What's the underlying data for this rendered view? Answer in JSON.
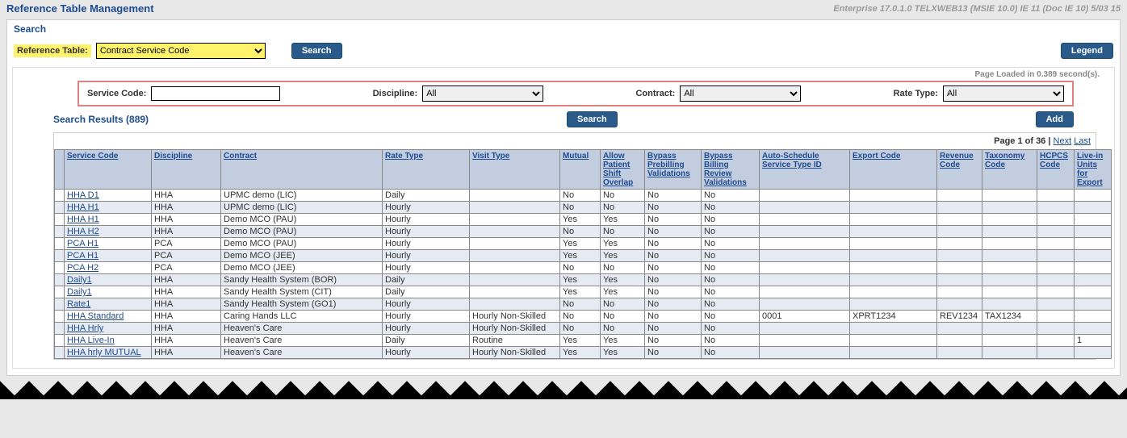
{
  "header": {
    "title": "Reference Table Management",
    "env": "Enterprise 17.0.1.0 TELXWEB13 (MSIE 10.0) IE 11 (Doc IE 10) 5/03 15"
  },
  "search": {
    "heading": "Search",
    "refTableLabel": "Reference Table:",
    "refTableValue": "Contract Service Code",
    "searchBtn": "Search",
    "legendBtn": "Legend",
    "pageLoaded": "Page Loaded in 0.389 second(s)."
  },
  "filters": {
    "serviceCodeLabel": "Service Code:",
    "serviceCodeValue": "",
    "disciplineLabel": "Discipline:",
    "disciplineValue": "All",
    "contractLabel": "Contract:",
    "contractValue": "All",
    "rateTypeLabel": "Rate Type:",
    "rateTypeValue": "All"
  },
  "results": {
    "title": "Search Results (889)",
    "searchBtn": "Search",
    "addBtn": "Add"
  },
  "pager": {
    "text": "Page 1 of 36 |",
    "next": "Next",
    "last": "Last"
  },
  "columns": [
    "Service Code",
    "Discipline",
    "Contract",
    "Rate Type",
    "Visit Type",
    "Mutual",
    "Allow Patient Shift Overlap",
    "Bypass Prebilling Validations",
    "Bypass Billing Review Validations",
    "Auto-Schedule Service Type ID",
    "Export Code",
    "Revenue Code",
    "Taxonomy Code",
    "HCPCS Code",
    "Live-in Units for Export"
  ],
  "rows": [
    {
      "sc": "HHA D1",
      "disc": "HHA",
      "con": "UPMC demo (LIC)",
      "rate": "Daily",
      "vt": "",
      "mut": "No",
      "ov": "No",
      "pre": "No",
      "bill": "No",
      "auto": "",
      "exp": "",
      "rev": "",
      "tax": "",
      "hc": "",
      "liv": ""
    },
    {
      "sc": "HHA H1",
      "disc": "HHA",
      "con": "UPMC demo (LIC)",
      "rate": "Hourly",
      "vt": "",
      "mut": "No",
      "ov": "No",
      "pre": "No",
      "bill": "No",
      "auto": "",
      "exp": "",
      "rev": "",
      "tax": "",
      "hc": "",
      "liv": ""
    },
    {
      "sc": "HHA H1",
      "disc": "HHA",
      "con": "Demo MCO (PAU)",
      "rate": "Hourly",
      "vt": "",
      "mut": "Yes",
      "ov": "Yes",
      "pre": "No",
      "bill": "No",
      "auto": "",
      "exp": "",
      "rev": "",
      "tax": "",
      "hc": "",
      "liv": ""
    },
    {
      "sc": "HHA H2",
      "disc": "HHA",
      "con": "Demo MCO (PAU)",
      "rate": "Hourly",
      "vt": "",
      "mut": "No",
      "ov": "No",
      "pre": "No",
      "bill": "No",
      "auto": "",
      "exp": "",
      "rev": "",
      "tax": "",
      "hc": "",
      "liv": ""
    },
    {
      "sc": "PCA H1",
      "disc": "PCA",
      "con": "Demo MCO (PAU)",
      "rate": "Hourly",
      "vt": "",
      "mut": "Yes",
      "ov": "Yes",
      "pre": "No",
      "bill": "No",
      "auto": "",
      "exp": "",
      "rev": "",
      "tax": "",
      "hc": "",
      "liv": ""
    },
    {
      "sc": "PCA H1",
      "disc": "PCA",
      "con": "Demo MCO (JEE)",
      "rate": "Hourly",
      "vt": "",
      "mut": "Yes",
      "ov": "Yes",
      "pre": "No",
      "bill": "No",
      "auto": "",
      "exp": "",
      "rev": "",
      "tax": "",
      "hc": "",
      "liv": ""
    },
    {
      "sc": "PCA H2",
      "disc": "PCA",
      "con": "Demo MCO (JEE)",
      "rate": "Hourly",
      "vt": "",
      "mut": "No",
      "ov": "No",
      "pre": "No",
      "bill": "No",
      "auto": "",
      "exp": "",
      "rev": "",
      "tax": "",
      "hc": "",
      "liv": ""
    },
    {
      "sc": "Daily1",
      "disc": "HHA",
      "con": "Sandy Health System (BOR)",
      "rate": "Daily",
      "vt": "",
      "mut": "Yes",
      "ov": "Yes",
      "pre": "No",
      "bill": "No",
      "auto": "",
      "exp": "",
      "rev": "",
      "tax": "",
      "hc": "",
      "liv": ""
    },
    {
      "sc": "Daily1",
      "disc": "HHA",
      "con": "Sandy Health System (CIT)",
      "rate": "Daily",
      "vt": "",
      "mut": "Yes",
      "ov": "Yes",
      "pre": "No",
      "bill": "No",
      "auto": "",
      "exp": "",
      "rev": "",
      "tax": "",
      "hc": "",
      "liv": ""
    },
    {
      "sc": "Rate1",
      "disc": "HHA",
      "con": "Sandy Health System (GO1)",
      "rate": "Hourly",
      "vt": "",
      "mut": "No",
      "ov": "No",
      "pre": "No",
      "bill": "No",
      "auto": "",
      "exp": "",
      "rev": "",
      "tax": "",
      "hc": "",
      "liv": ""
    },
    {
      "sc": "HHA Standard",
      "disc": "HHA",
      "con": "Caring Hands LLC",
      "rate": "Hourly",
      "vt": "Hourly Non-Skilled",
      "mut": "No",
      "ov": "No",
      "pre": "No",
      "bill": "No",
      "auto": "0001",
      "exp": "XPRT1234",
      "rev": "REV1234",
      "tax": "TAX1234",
      "hc": "",
      "liv": ""
    },
    {
      "sc": "HHA Hrly",
      "disc": "HHA",
      "con": "Heaven's Care",
      "rate": "Hourly",
      "vt": "Hourly Non-Skilled",
      "mut": "No",
      "ov": "No",
      "pre": "No",
      "bill": "No",
      "auto": "",
      "exp": "",
      "rev": "",
      "tax": "",
      "hc": "",
      "liv": ""
    },
    {
      "sc": "HHA Live-In",
      "disc": "HHA",
      "con": "Heaven's Care",
      "rate": "Daily",
      "vt": "Routine",
      "mut": "Yes",
      "ov": "Yes",
      "pre": "No",
      "bill": "No",
      "auto": "",
      "exp": "",
      "rev": "",
      "tax": "",
      "hc": "",
      "liv": "1"
    },
    {
      "sc": "HHA hrly MUTUAL",
      "disc": "HHA",
      "con": "Heaven's Care",
      "rate": "Hourly",
      "vt": "Hourly Non-Skilled",
      "mut": "Yes",
      "ov": "Yes",
      "pre": "No",
      "bill": "No",
      "auto": "",
      "exp": "",
      "rev": "",
      "tax": "",
      "hc": "",
      "liv": ""
    }
  ]
}
